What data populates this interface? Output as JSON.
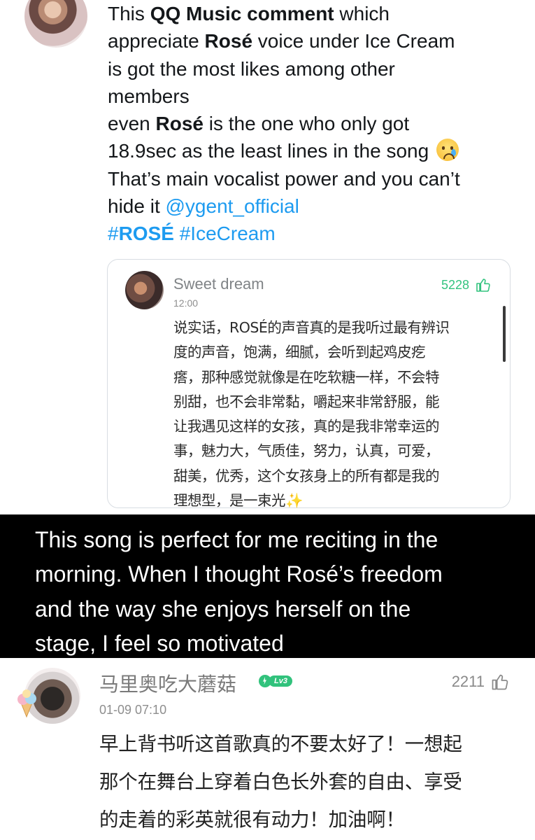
{
  "tweet": {
    "lines": [
      [
        {
          "t": "This ",
          "b": false
        },
        {
          "t": "QQ Music comment",
          "b": true
        },
        {
          "t": " which",
          "b": false
        }
      ],
      [
        {
          "t": "appreciate ",
          "b": false
        },
        {
          "t": "Rosé",
          "b": true
        },
        {
          "t": " voice under Ice Cream",
          "b": false
        }
      ],
      [
        {
          "t": "is got the most likes among other",
          "b": false
        }
      ],
      [
        {
          "t": "members",
          "b": false
        }
      ],
      [
        {
          "t": "even ",
          "b": false
        },
        {
          "t": "Rosé",
          "b": true
        },
        {
          "t": " is the one who only got",
          "b": false
        }
      ],
      [
        {
          "t": "18.9sec as the least lines in the song",
          "b": false
        }
      ],
      [
        {
          "t": "That’s main vocalist power and you can’t",
          "b": false
        }
      ],
      [
        {
          "t": "hide it ",
          "b": false
        }
      ],
      []
    ],
    "mention": "@ygent_official",
    "hashtag_prefix": "#",
    "hashtag_bold": "ROSÉ",
    "hashtag_two": "#IceCream",
    "emoji": "crying-face-emoji"
  },
  "quoted_comment": {
    "user": "Sweet dream",
    "time": "12:00",
    "likes": "5228",
    "body_lines": [
      "说实话，ROSÉ的声音真的是我听过最有辨识",
      "度的声音，饱满，细腻，会听到起鸡皮疙",
      "瘩，那种感觉就像是在吃软糖一样，不会特",
      "别甜，也不会非常黏，嚼起来非常舒服，能",
      "让我遇见这样的女孩，真的是我非常幸运的",
      "事，魅力大，气质佳，努力，认真，可爱，",
      "甜美，优秀，这个女孩身上的所有都是我的",
      "理想型，是一束光"
    ],
    "sparkle": "✨",
    "accent_color": "#33c37f"
  },
  "caption": {
    "lines": [
      "This song is perfect for me reciting in the",
      "morning. When I thought Rosé’s freedom",
      "and the way she enjoys herself on the",
      "stage, I feel so motivated"
    ]
  },
  "comment": {
    "user": "马里奥吃大蘑菇",
    "level": "Lv3",
    "time": "01-09 07:10",
    "likes": "2211",
    "body_lines": [
      "早上背书听这首歌真的不要太好了！一想起",
      "那个在舞台上穿着白色长外套的自由、享受",
      "的走着的彩英就很有动力！加油啊！"
    ],
    "badge_color": "#31c27c"
  }
}
